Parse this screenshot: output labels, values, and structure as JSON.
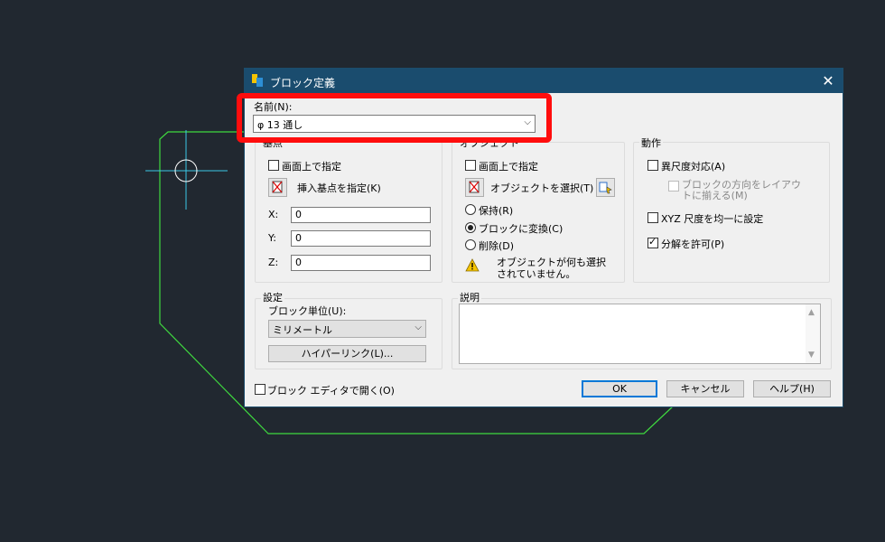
{
  "dialog": {
    "title": "ブロック定義",
    "close_glyph": "✕"
  },
  "name": {
    "label": "名前(N):",
    "value": "φ 13 通し",
    "arrow": "⌵"
  },
  "base_point": {
    "group_title": "基点",
    "specify_on_screen": "画面上で指定",
    "pick_label": "挿入基点を指定(K)",
    "x_label": "X:",
    "y_label": "Y:",
    "z_label": "Z:",
    "x_value": "0",
    "y_value": "0",
    "z_value": "0"
  },
  "objects": {
    "group_title": "オブジェクト",
    "specify_on_screen": "画面上で指定",
    "select_label": "オブジェクトを選択(T)",
    "retain": "保持(R)",
    "convert": "ブロックに変換(C)",
    "delete": "削除(D)",
    "warning": "オブジェクトが何も選択されていません。"
  },
  "behavior": {
    "group_title": "動作",
    "annotative": "異尺度対応(A)",
    "match_orientation": "ブロックの方向をレイアウトに揃える(M)",
    "scale_uniformly": "XYZ 尺度を均一に設定",
    "allow_exploding": "分解を許可(P)",
    "allow_exploding_checked": true
  },
  "settings": {
    "group_title": "設定",
    "unit_label": "ブロック単位(U):",
    "unit_value": "ミリメートル",
    "unit_arrow": "⌵",
    "hyperlink": "ハイパーリンク(L)..."
  },
  "description": {
    "group_title": "説明",
    "scroll_up": "▲",
    "scroll_down": "▼"
  },
  "footer": {
    "open_in_editor": "ブロック エディタで開く(O)",
    "ok": "OK",
    "cancel": "キャンセル",
    "help": "ヘルプ(H)"
  },
  "colors": {
    "background": "#212830",
    "titlebar": "#1a4c6e",
    "cad_line": "#3fd93f",
    "cad_crosshair": "#3cc8e6",
    "highlight": "#ff0d0d"
  }
}
